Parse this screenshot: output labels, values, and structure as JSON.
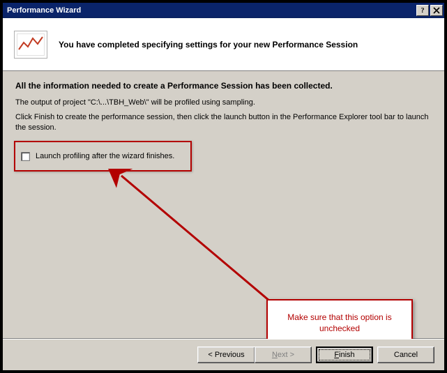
{
  "window": {
    "title": "Performance Wizard"
  },
  "header": {
    "heading": "You have completed specifying settings for your new Performance Session"
  },
  "body": {
    "collected": "All the information needed to create a Performance Session has been collected.",
    "output_line": "The output of project  \"C:\\...\\TBH_Web\\\" will be profiled using sampling.",
    "instruction": "Click Finish to create the performance session, then click the launch button in the Performance Explorer tool bar to launch the session.",
    "checkbox_label": "Launch profiling after the wizard finishes.",
    "checkbox_checked": false
  },
  "annotation": {
    "callout_text": "Make sure that this option is unchecked"
  },
  "buttons": {
    "previous": "< Previous",
    "next_prefix": "N",
    "next_rest": "ext >",
    "finish_prefix": "F",
    "finish_rest": "inish",
    "cancel": "Cancel"
  },
  "colors": {
    "annotation_red": "#b30000",
    "titlebar_blue": "#0a246a",
    "dialog_face": "#d4d0c8"
  }
}
